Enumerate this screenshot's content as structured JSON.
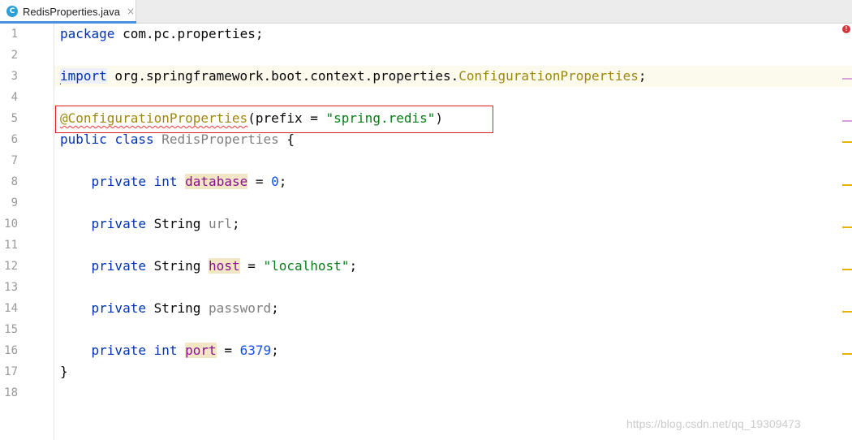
{
  "tab": {
    "icon_letter": "C",
    "file_name": "RedisProperties.java",
    "close_glyph": "×"
  },
  "line_numbers": [
    "1",
    "2",
    "3",
    "4",
    "5",
    "6",
    "7",
    "8",
    "9",
    "10",
    "11",
    "12",
    "13",
    "14",
    "15",
    "16",
    "17",
    "18"
  ],
  "code": {
    "l1": {
      "kw": "package",
      "rest": " com.pc.properties;"
    },
    "l3": {
      "kw": "import",
      "pkg": " org.springframework.boot.context.properties.",
      "cls": "ConfigurationProperties",
      "end": ";"
    },
    "l5": {
      "ann": "@ConfigurationProperties",
      "open": "(prefix = ",
      "str": "\"spring.redis\"",
      "close": ")"
    },
    "l6": {
      "kw1": "public",
      "kw2": "class",
      "name": "RedisProperties",
      "brace": " {"
    },
    "l8": {
      "kw": "private",
      "type": "int",
      "field": "database",
      "eq": " = ",
      "num": "0",
      "end": ";"
    },
    "l10": {
      "kw": "private",
      "type": "String",
      "field": "url",
      "end": ";"
    },
    "l12": {
      "kw": "private",
      "type": "String",
      "field": "host",
      "eq": " = ",
      "str": "\"localhost\"",
      "end": ";"
    },
    "l14": {
      "kw": "private",
      "type": "String",
      "field": "password",
      "end": ";"
    },
    "l16": {
      "kw": "private",
      "type": "int",
      "field": "port",
      "eq": " = ",
      "num": "6379",
      "end": ";"
    },
    "l17": {
      "brace": "}"
    }
  },
  "error_indicator": "!",
  "marker_colors": {
    "error": "#d8333a",
    "info": "#d9a0e0",
    "warning": "#e6b400"
  },
  "watermark": "https://blog.csdn.net/qq_19309473"
}
